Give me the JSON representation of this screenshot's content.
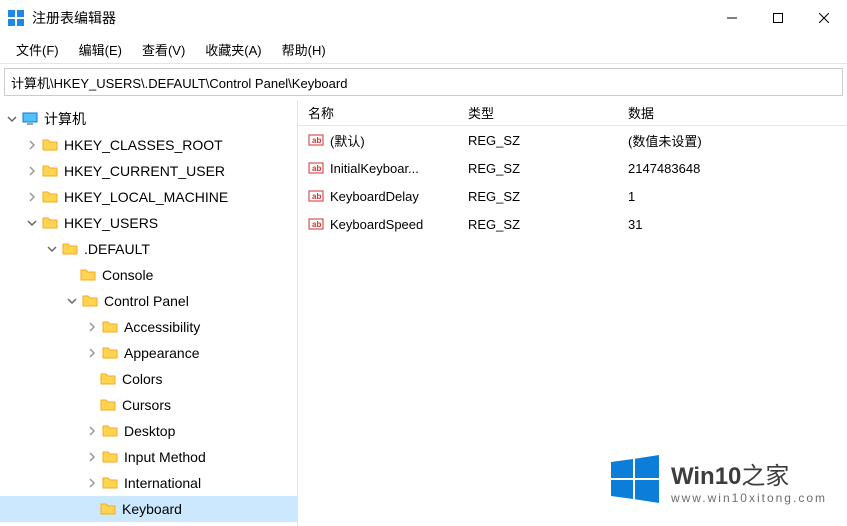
{
  "title": "注册表编辑器",
  "menubar": {
    "file": "文件(F)",
    "edit": "编辑(E)",
    "view": "查看(V)",
    "favorites": "收藏夹(A)",
    "help": "帮助(H)"
  },
  "address": "计算机\\HKEY_USERS\\.DEFAULT\\Control Panel\\Keyboard",
  "tree": {
    "root": "计算机",
    "hkcr": "HKEY_CLASSES_ROOT",
    "hkcu": "HKEY_CURRENT_USER",
    "hklm": "HKEY_LOCAL_MACHINE",
    "hku": "HKEY_USERS",
    "default": ".DEFAULT",
    "console": "Console",
    "cp": "Control Panel",
    "accessibility": "Accessibility",
    "appearance": "Appearance",
    "colors": "Colors",
    "cursors": "Cursors",
    "desktop": "Desktop",
    "inputmethod": "Input Method",
    "international": "International",
    "keyboard": "Keyboard"
  },
  "list": {
    "header": {
      "name": "名称",
      "type": "类型",
      "data": "数据"
    },
    "rows": [
      {
        "name": "(默认)",
        "type": "REG_SZ",
        "data": "(数值未设置)"
      },
      {
        "name": "InitialKeyboar...",
        "type": "REG_SZ",
        "data": "2147483648"
      },
      {
        "name": "KeyboardDelay",
        "type": "REG_SZ",
        "data": "1"
      },
      {
        "name": "KeyboardSpeed",
        "type": "REG_SZ",
        "data": "31"
      }
    ]
  },
  "watermark": {
    "brand": "Win10",
    "suffix": "之家",
    "url": "www.win10xitong.com"
  }
}
